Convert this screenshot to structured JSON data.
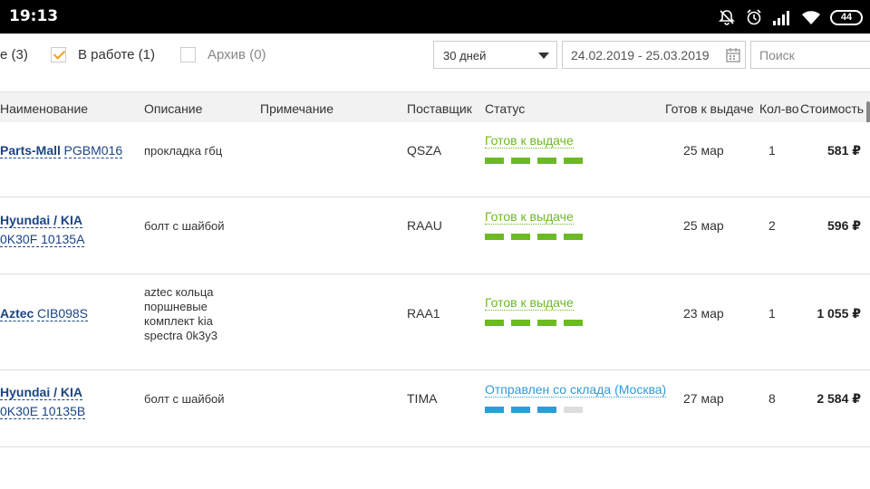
{
  "status_bar": {
    "time": "19:13",
    "battery": "44",
    "icons": [
      "notifications-off-icon",
      "alarm-icon",
      "signal-icon",
      "wifi-icon",
      "battery-icon"
    ]
  },
  "filters": {
    "all_label": "е (3)",
    "in_work_label": "В работе (1)",
    "in_work_checked": true,
    "archive_label": "Архив (0)",
    "archive_checked": false,
    "period_select": "30 дней",
    "date_range": "24.02.2019 - 25.03.2019",
    "search_placeholder": "Поиск"
  },
  "table": {
    "headers": {
      "name": "Наименование",
      "description": "Описание",
      "note": "Примечание",
      "supplier": "Поставщик",
      "status": "Статус",
      "ready": "Готов к выдаче",
      "qty": "Кол-во",
      "cost": "Стоимость"
    },
    "rows": [
      {
        "brand": "Parts-Mall",
        "code": "PGBM016",
        "description": "прокладка гбц",
        "note": "",
        "supplier": "QSZA",
        "status": "Готов к выдаче",
        "status_color": "#6cba23",
        "progress_steps": [
          1,
          1,
          1,
          1
        ],
        "ready_date": "25 мар",
        "qty": "1",
        "cost": "581 ₽"
      },
      {
        "brand": "Hyundai / KIA",
        "code": "0K30F 10135A",
        "description": "болт с шайбой",
        "note": "",
        "supplier": "RAAU",
        "status": "Готов к выдаче",
        "status_color": "#6cba23",
        "progress_steps": [
          1,
          1,
          1,
          1
        ],
        "ready_date": "25 мар",
        "qty": "2",
        "cost": "596 ₽"
      },
      {
        "brand": "Aztec",
        "code": "CIB098S",
        "description": "aztec кольца поршневые комплект kia spectra 0k3y3",
        "note": "",
        "supplier": "RAA1",
        "status": "Готов к выдаче",
        "status_color": "#6cba23",
        "progress_steps": [
          1,
          1,
          1,
          1
        ],
        "ready_date": "23 мар",
        "qty": "1",
        "cost": "1 055 ₽"
      },
      {
        "brand": "Hyundai / KIA",
        "code": "0K30E 10135B",
        "description": "болт с шайбой",
        "note": "",
        "supplier": "TIMA",
        "status": "Отправлен со склада (Москва)",
        "status_color": "#2f9bd7",
        "progress_steps": [
          1,
          1,
          1,
          0
        ],
        "ready_date": "27 мар",
        "qty": "8",
        "cost": "2 584 ₽"
      }
    ]
  }
}
